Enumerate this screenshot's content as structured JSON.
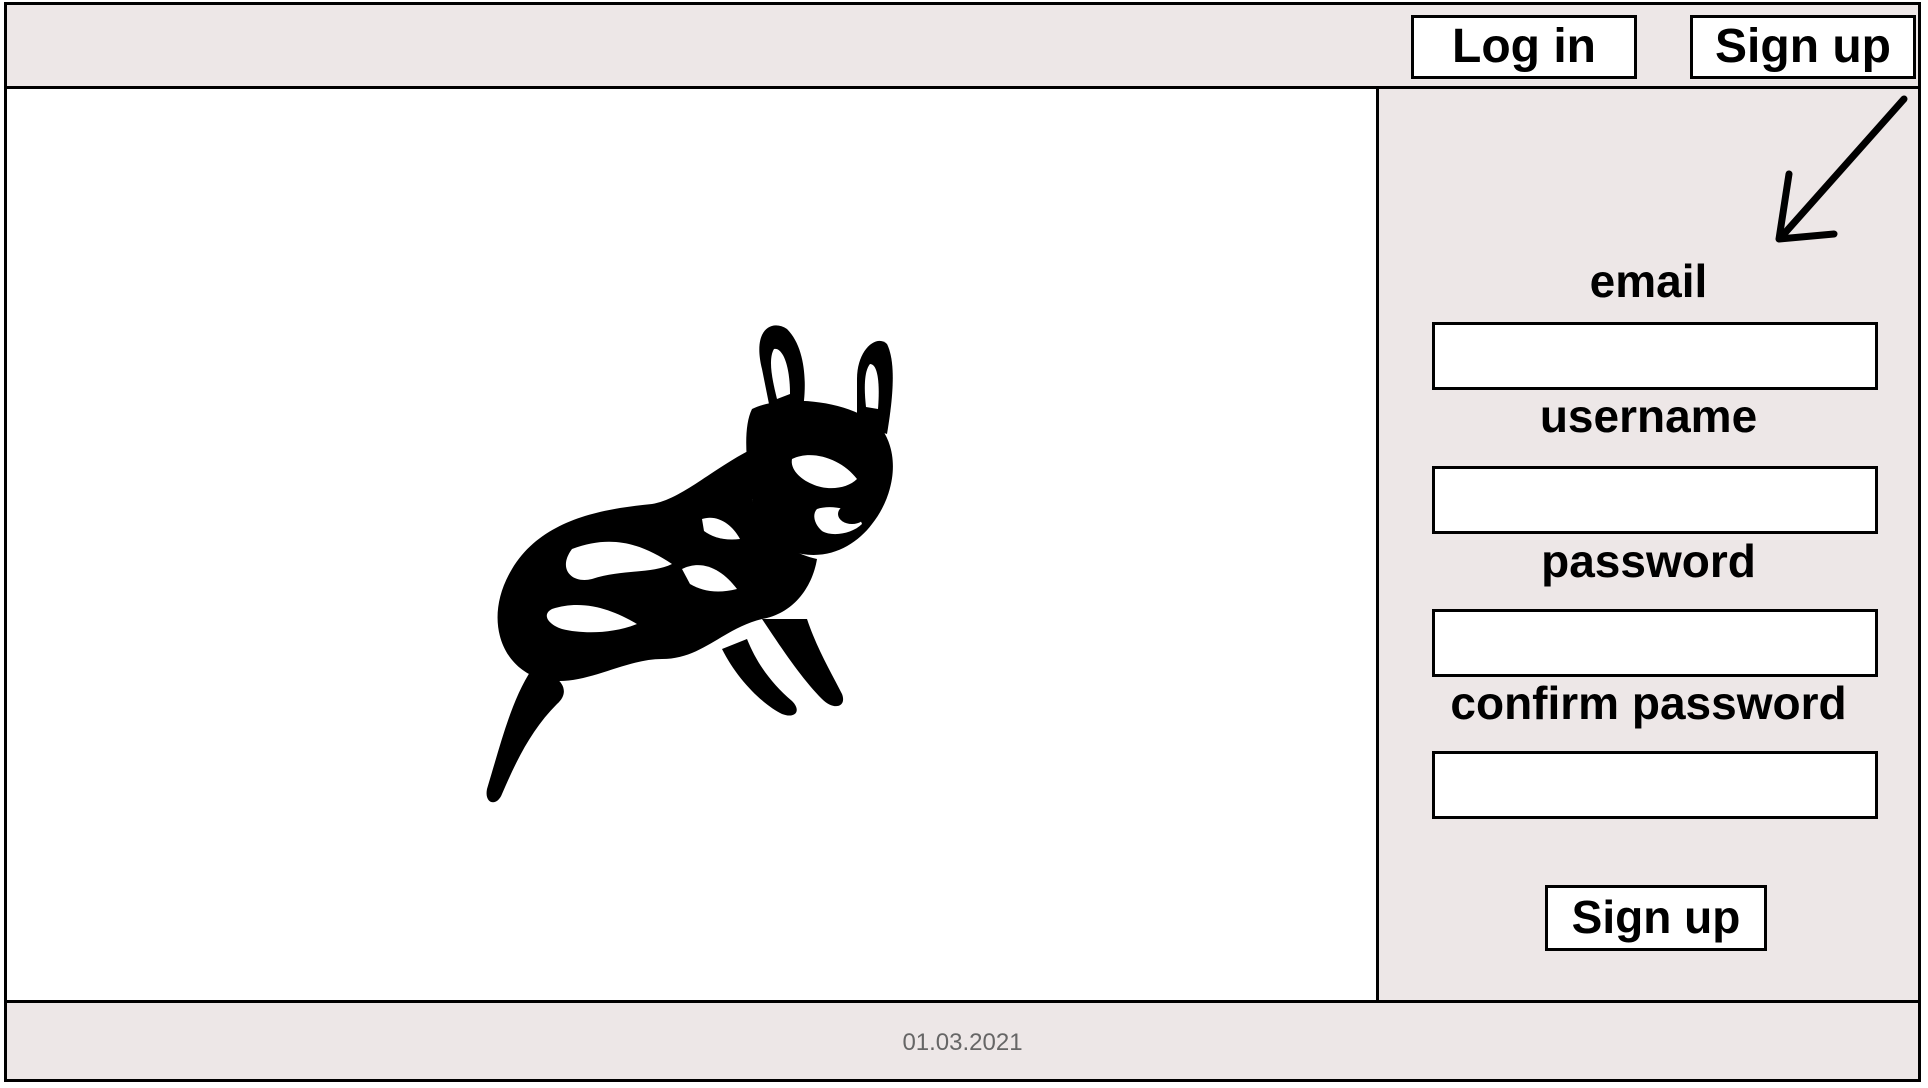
{
  "header": {
    "login_label": "Log in",
    "signup_label": "Sign up"
  },
  "hero": {
    "image": "running-dog-illustration"
  },
  "signup_form": {
    "email_label": "email",
    "username_label": "username",
    "password_label": "password",
    "confirm_password_label": "confirm password",
    "email_value": "",
    "username_value": "",
    "password_value": "",
    "confirm_password_value": "",
    "submit_label": "Sign up",
    "pointer_icon": "arrow-down-left-icon"
  },
  "footer": {
    "date": "01.03.2021"
  },
  "colors": {
    "panel_background": "#ede7e7",
    "border": "#000000",
    "footer_text": "#666666"
  }
}
